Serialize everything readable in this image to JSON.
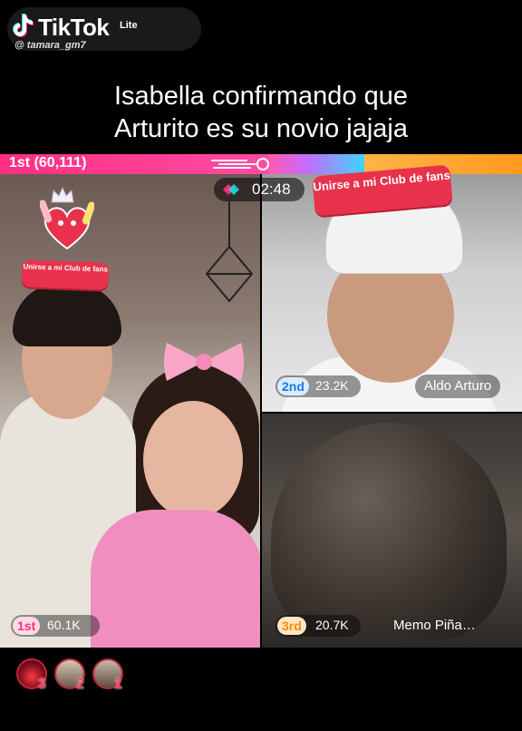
{
  "watermark": {
    "brand": "TikTok",
    "variant": "Lite",
    "username": "@ tamara_gm7"
  },
  "caption": {
    "line1": "Isabella confirmando que",
    "line2": "Arturito es su novio jajaja"
  },
  "battle": {
    "leader_label": "1st (60,111)",
    "timer": "02:48",
    "fan_club_sticker": "Unirse a mi Club de fans",
    "participants": [
      {
        "rank": "1st",
        "score": "60.1K",
        "name": "",
        "rank_color": "#ff2f72"
      },
      {
        "rank": "2nd",
        "score": "23.2K",
        "name": "Aldo Arturo",
        "rank_color": "#1c7ae6"
      },
      {
        "rank": "3rd",
        "score": "20.7K",
        "name": "Memo Piña…",
        "rank_color": "#ff8a00"
      }
    ]
  },
  "gifters": [
    {
      "position": "3",
      "icon": "gifter-avatar-icon"
    },
    {
      "position": "2",
      "icon": "gifter-avatar-icon"
    },
    {
      "position": "1",
      "icon": "gifter-avatar-icon"
    }
  ],
  "colors": {
    "strip_pink": "#ff2f83",
    "strip_orange": "#ff9a1f",
    "sticker_red": "#e8324d"
  }
}
